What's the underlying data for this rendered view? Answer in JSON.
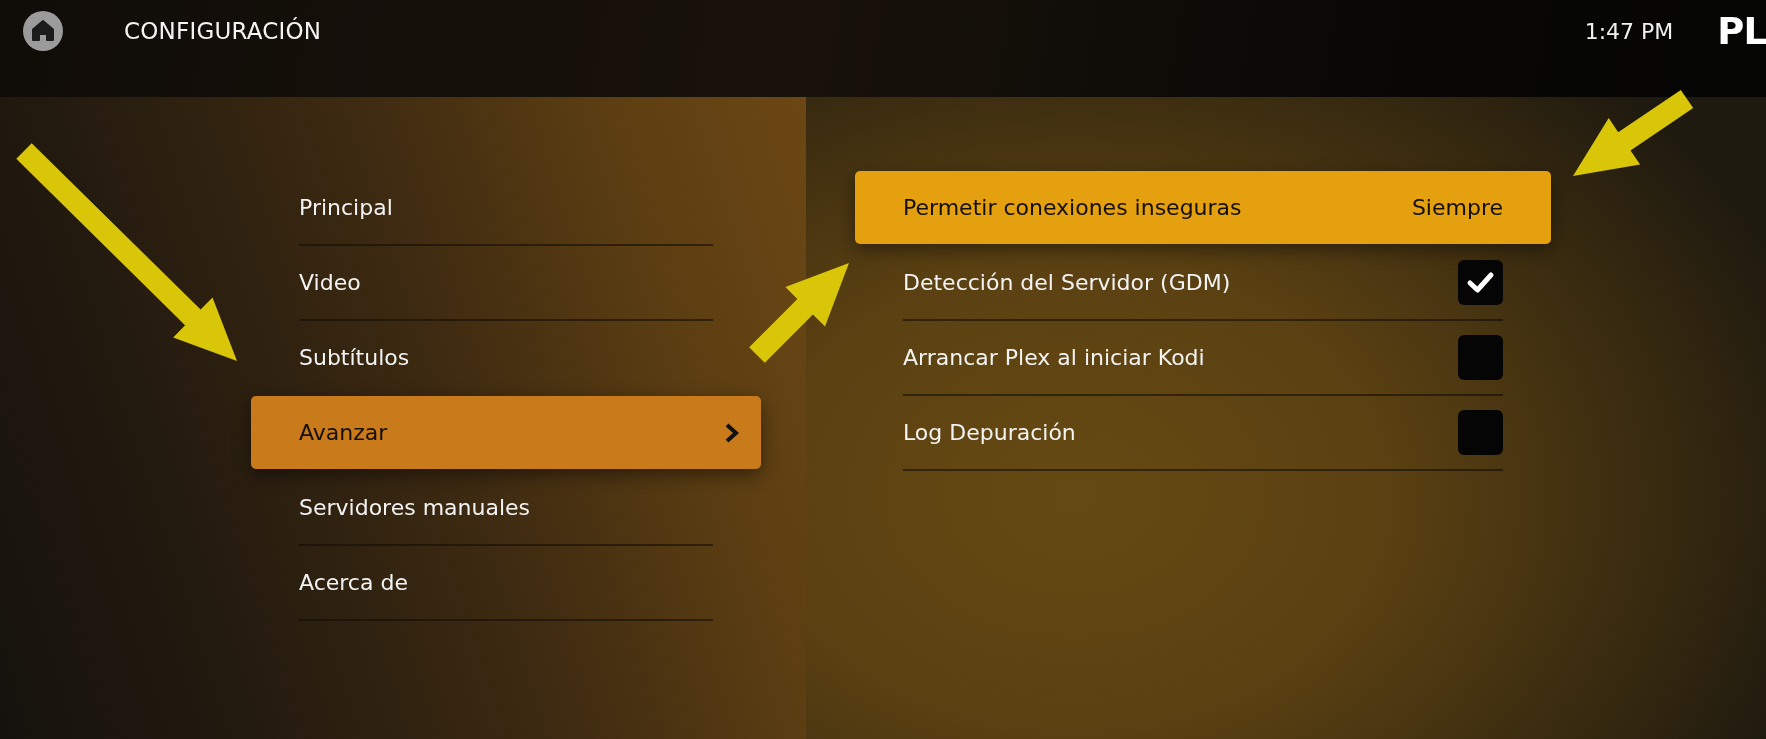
{
  "header": {
    "title": "CONFIGURACIÓN",
    "time": "1:47 PM",
    "logo_text": "PL"
  },
  "menu": {
    "items": [
      {
        "label": "Principal",
        "selected": false
      },
      {
        "label": "Video",
        "selected": false
      },
      {
        "label": "Subtítulos",
        "selected": false
      },
      {
        "label": "Avanzar",
        "selected": true
      },
      {
        "label": "Servidores manuales",
        "selected": false
      },
      {
        "label": "Acerca de",
        "selected": false
      }
    ]
  },
  "settings": {
    "rows": [
      {
        "kind": "option",
        "label": "Permetir conexiones inseguras",
        "value": "Siempre",
        "selected": true
      },
      {
        "kind": "checkbox",
        "label": "Detección del Servidor (GDM)",
        "checked": true,
        "selected": false
      },
      {
        "kind": "checkbox",
        "label": "Arrancar Plex al iniciar Kodi",
        "checked": false,
        "selected": false
      },
      {
        "kind": "checkbox",
        "label": "Log Depuración",
        "checked": false,
        "selected": false
      }
    ]
  }
}
